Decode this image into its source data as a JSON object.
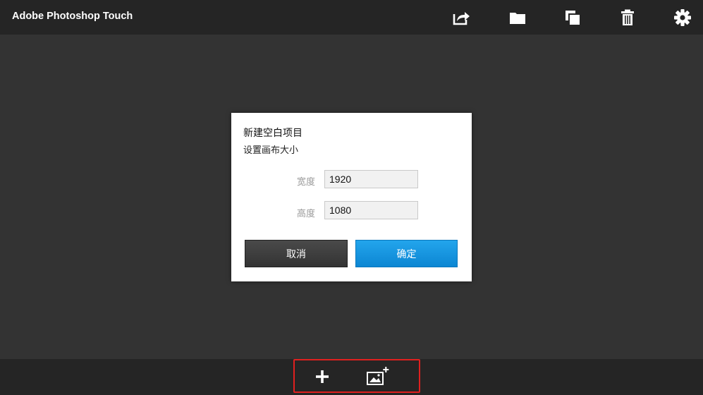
{
  "app": {
    "title": "Adobe Photoshop Touch"
  },
  "toolbar": {
    "icons": [
      "share-icon",
      "folder-icon",
      "duplicate-icon",
      "trash-icon",
      "gear-icon"
    ]
  },
  "dialog": {
    "title": "新建空白项目",
    "subtitle": "设置画布大小",
    "width_label": "宽度",
    "width_value": "1920",
    "height_label": "高度",
    "height_value": "1080",
    "cancel_label": "取消",
    "confirm_label": "确定"
  },
  "bottom_bar": {
    "icons": [
      "plus-icon",
      "add-image-icon"
    ]
  },
  "colors": {
    "bar_background": "#252525",
    "workspace_background": "#333333",
    "confirm_button": "#1596e0",
    "highlight_border": "#e0201f"
  }
}
